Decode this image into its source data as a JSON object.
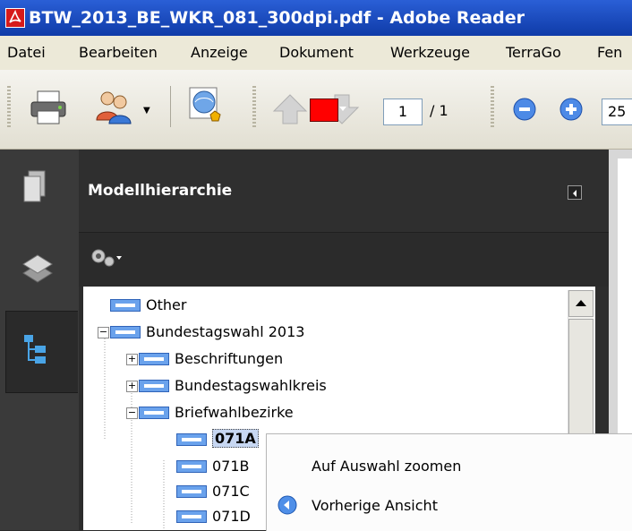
{
  "window": {
    "title": "BTW_2013_BE_WKR_081_300dpi.pdf - Adobe Reader"
  },
  "menu": {
    "items": [
      "Datei",
      "Bearbeiten",
      "Anzeige",
      "Dokument",
      "Werkzeuge",
      "TerraGo",
      "Fen"
    ]
  },
  "toolbar": {
    "page_number": "1",
    "page_total": "/ 1",
    "zoom_value": "25"
  },
  "panel": {
    "title": "Modellhierarchie",
    "accent_color": "#ff0000"
  },
  "tree": {
    "items": [
      {
        "label": "Other"
      },
      {
        "label": "Bundestagswahl 2013",
        "expander": "−"
      },
      {
        "label": "Beschriftungen",
        "expander": "+"
      },
      {
        "label": "Bundestagswahlkreis",
        "expander": "+"
      },
      {
        "label": "Briefwahlbezirke",
        "expander": "−"
      },
      {
        "label": "071A"
      },
      {
        "label": "071B"
      },
      {
        "label": "071C"
      },
      {
        "label": "071D"
      }
    ]
  },
  "context_menu": {
    "zoom_selection": "Auf Auswahl zoomen",
    "previous_view": "Vorherige Ansicht"
  }
}
